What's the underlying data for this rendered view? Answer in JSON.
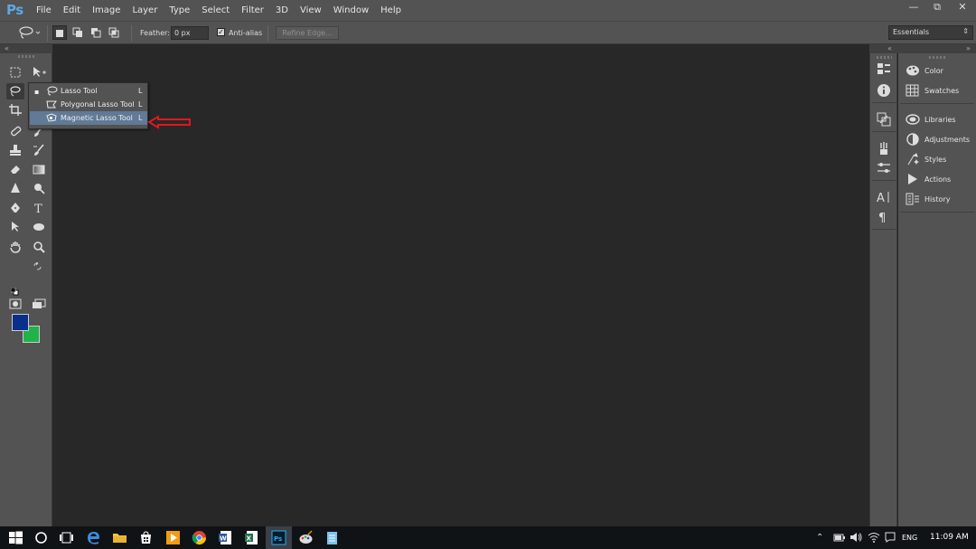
{
  "app": {
    "logo": "Ps",
    "menu": [
      "File",
      "Edit",
      "Image",
      "Layer",
      "Type",
      "Select",
      "Filter",
      "3D",
      "View",
      "Window",
      "Help"
    ],
    "window_controls": {
      "minimize": "—",
      "restore": "⧉",
      "close": "✕"
    }
  },
  "options_bar": {
    "feather_label": "Feather:",
    "feather_value": "0 px",
    "antialias_label": "Anti-alias",
    "antialias_checked": true,
    "refine_edge": "Refine Edge...",
    "workspace": "Essentials"
  },
  "flyout": {
    "items": [
      {
        "label": "Lasso Tool",
        "key": "L",
        "selected": true
      },
      {
        "label": "Polygonal Lasso Tool",
        "key": "L",
        "selected": false
      },
      {
        "label": "Magnetic Lasso Tool",
        "key": "L",
        "selected": false,
        "highlighted": true
      }
    ]
  },
  "colors": {
    "foreground": "#0a2f8a",
    "background": "#1fb34a",
    "annotation_arrow": "#e0181f",
    "highlight": "#607a97"
  },
  "panels": {
    "items": [
      "Color",
      "Swatches",
      "Libraries",
      "Adjustments",
      "Styles",
      "Actions",
      "History"
    ]
  },
  "taskbar": {
    "language": "ENG",
    "time": "11:09 AM"
  }
}
